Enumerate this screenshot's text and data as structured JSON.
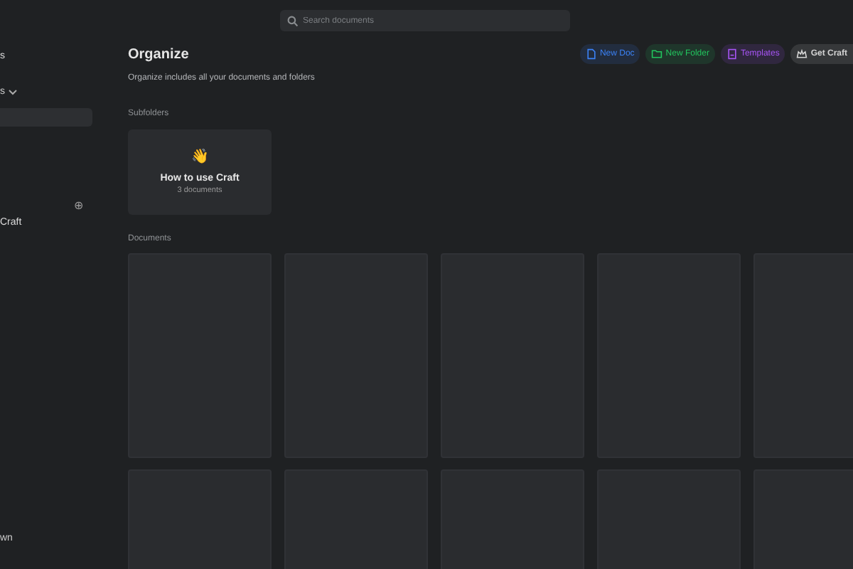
{
  "search": {
    "placeholder": "Search documents"
  },
  "sidebar": {
    "items": [
      {
        "kind": "label",
        "text": "s"
      },
      {
        "kind": "dropdown",
        "text": "s"
      },
      {
        "kind": "selected-row"
      },
      {
        "kind": "add",
        "text": "⊕"
      },
      {
        "kind": "label",
        "text": "Craft"
      },
      {
        "kind": "footer",
        "text": "wn"
      }
    ]
  },
  "header": {
    "title": "Organize",
    "subtitle": "Organize includes all your documents and folders"
  },
  "actions": [
    {
      "label": "New Doc",
      "color": "#3b82f6"
    },
    {
      "label": "New Folder",
      "color": "#22c55e"
    },
    {
      "label": "Templates",
      "color": "#a855f7"
    },
    {
      "label": "Get Craft",
      "color": "#d4d4d4"
    }
  ],
  "subfolders": {
    "heading": "Subfolders",
    "items": [
      {
        "emoji": "👋",
        "name": "How to use Craft",
        "count": "3 documents"
      }
    ]
  },
  "documents": {
    "heading": "Documents"
  }
}
